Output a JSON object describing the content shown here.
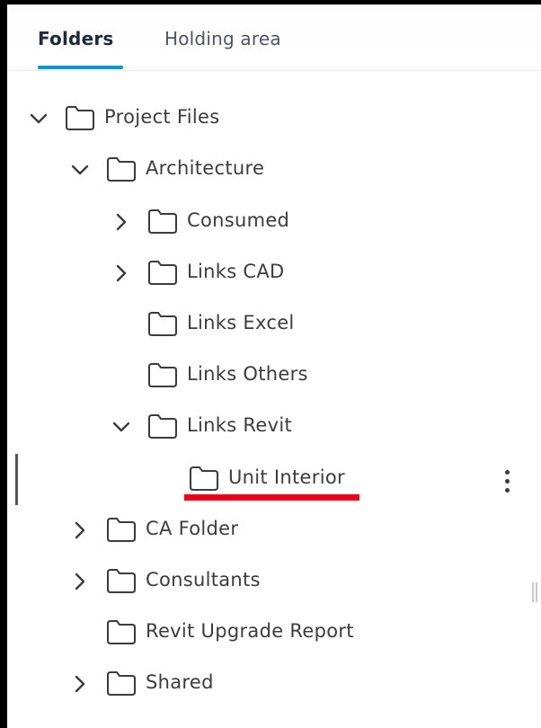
{
  "tabs": {
    "folders": "Folders",
    "holding_area": "Holding area"
  },
  "tree": {
    "project_files": "Project Files",
    "architecture": "Architecture",
    "consumed": "Consumed",
    "links_cad": "Links CAD",
    "links_excel": "Links Excel",
    "links_others": "Links Others",
    "links_revit": "Links Revit",
    "unit_interior": "Unit Interior",
    "ca_folder": "CA Folder",
    "consultants": "Consultants",
    "revit_upgrade_report": "Revit Upgrade Report",
    "shared": "Shared"
  },
  "colors": {
    "accent": "#0696d7",
    "annotation": "#e8001c",
    "text": "#3c3c3c"
  }
}
